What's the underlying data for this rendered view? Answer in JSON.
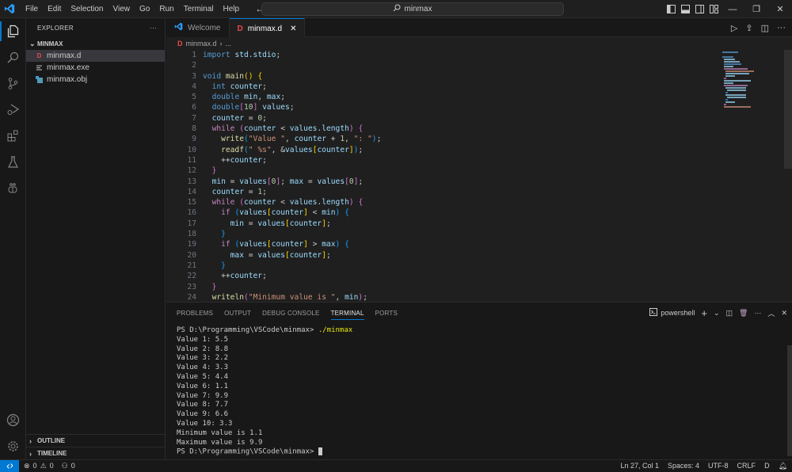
{
  "titlebar": {
    "menu": [
      "File",
      "Edit",
      "Selection",
      "View",
      "Go",
      "Run",
      "Terminal",
      "Help"
    ],
    "search_text": "minmax"
  },
  "sidebar": {
    "title": "EXPLORER",
    "more": "···",
    "folder": "MINMAX",
    "files": [
      {
        "name": "minmax.d",
        "icon": "d-file-icon",
        "selected": true
      },
      {
        "name": "minmax.exe",
        "icon": "binary-file-icon",
        "selected": false
      },
      {
        "name": "minmax.obj",
        "icon": "obj-file-icon",
        "selected": false
      }
    ],
    "sections": [
      "OUTLINE",
      "TIMELINE"
    ]
  },
  "tabs": [
    {
      "label": "Welcome",
      "active": false
    },
    {
      "label": "minmax.d",
      "active": true,
      "close": "✕"
    }
  ],
  "breadcrumb": {
    "file": "minmax.d",
    "sep": "›",
    "rest": "..."
  },
  "editor": {
    "lines": [
      "1",
      "2",
      "3",
      "4",
      "5",
      "6",
      "7",
      "8",
      "9",
      "10",
      "11",
      "12",
      "13",
      "14",
      "15",
      "16",
      "17",
      "18",
      "19",
      "20",
      "21",
      "22",
      "23",
      "24"
    ]
  },
  "panel": {
    "tabs": [
      "PROBLEMS",
      "OUTPUT",
      "DEBUG CONSOLE",
      "TERMINAL",
      "PORTS"
    ],
    "active_tab": "TERMINAL",
    "shell": "powershell",
    "prompt": "PS D:\\Programming\\VSCode\\minmax>",
    "command": "./minmax",
    "output": [
      "Value 1: 5.5",
      "Value 2: 8.8",
      "Value 3: 2.2",
      "Value 4: 3.3",
      "Value 5: 4.4",
      "Value 6: 1.1",
      "Value 7: 9.9",
      "Value 8: 7.7",
      "Value 9: 6.6",
      "Value 10: 3.3",
      "Minimum value is 1.1",
      "Maximum value is 9.9"
    ]
  },
  "statusbar": {
    "errors": "0",
    "warnings": "0",
    "ports": "0",
    "position": "Ln 27, Col 1",
    "spaces": "Spaces: 4",
    "encoding": "UTF-8",
    "eol": "CRLF",
    "language": "D"
  }
}
